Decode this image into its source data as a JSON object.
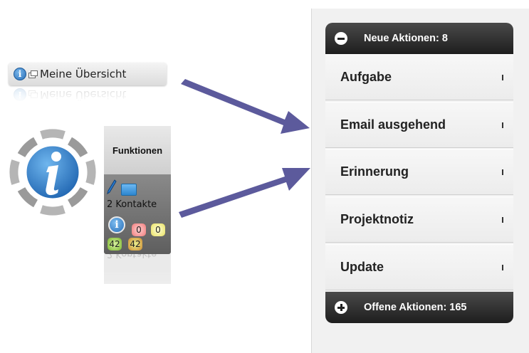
{
  "overview": {
    "label": "Meine Übersicht"
  },
  "functions_panel": {
    "title": "Funktionen",
    "contacts": "2 Kontakte",
    "badges": {
      "red": "0",
      "yellow": "0",
      "green": "42",
      "orange": "42"
    }
  },
  "actions": {
    "new_header": "Neue Aktionen: 8",
    "items": [
      {
        "label": "Aufgabe"
      },
      {
        "label": "Email ausgehend"
      },
      {
        "label": "Erinnerung"
      },
      {
        "label": "Projektnotiz"
      },
      {
        "label": "Update"
      }
    ],
    "open_header": "Offene Aktionen: 165"
  },
  "colors": {
    "arrow": "#5c5a9c",
    "header_dark": "#1e1e1e",
    "info_blue": "#2a6fb8"
  },
  "icons": [
    "info-icon",
    "window-icon",
    "pencil-icon",
    "folder-icon",
    "minus-icon",
    "plus-icon",
    "chevron-right-icon"
  ]
}
